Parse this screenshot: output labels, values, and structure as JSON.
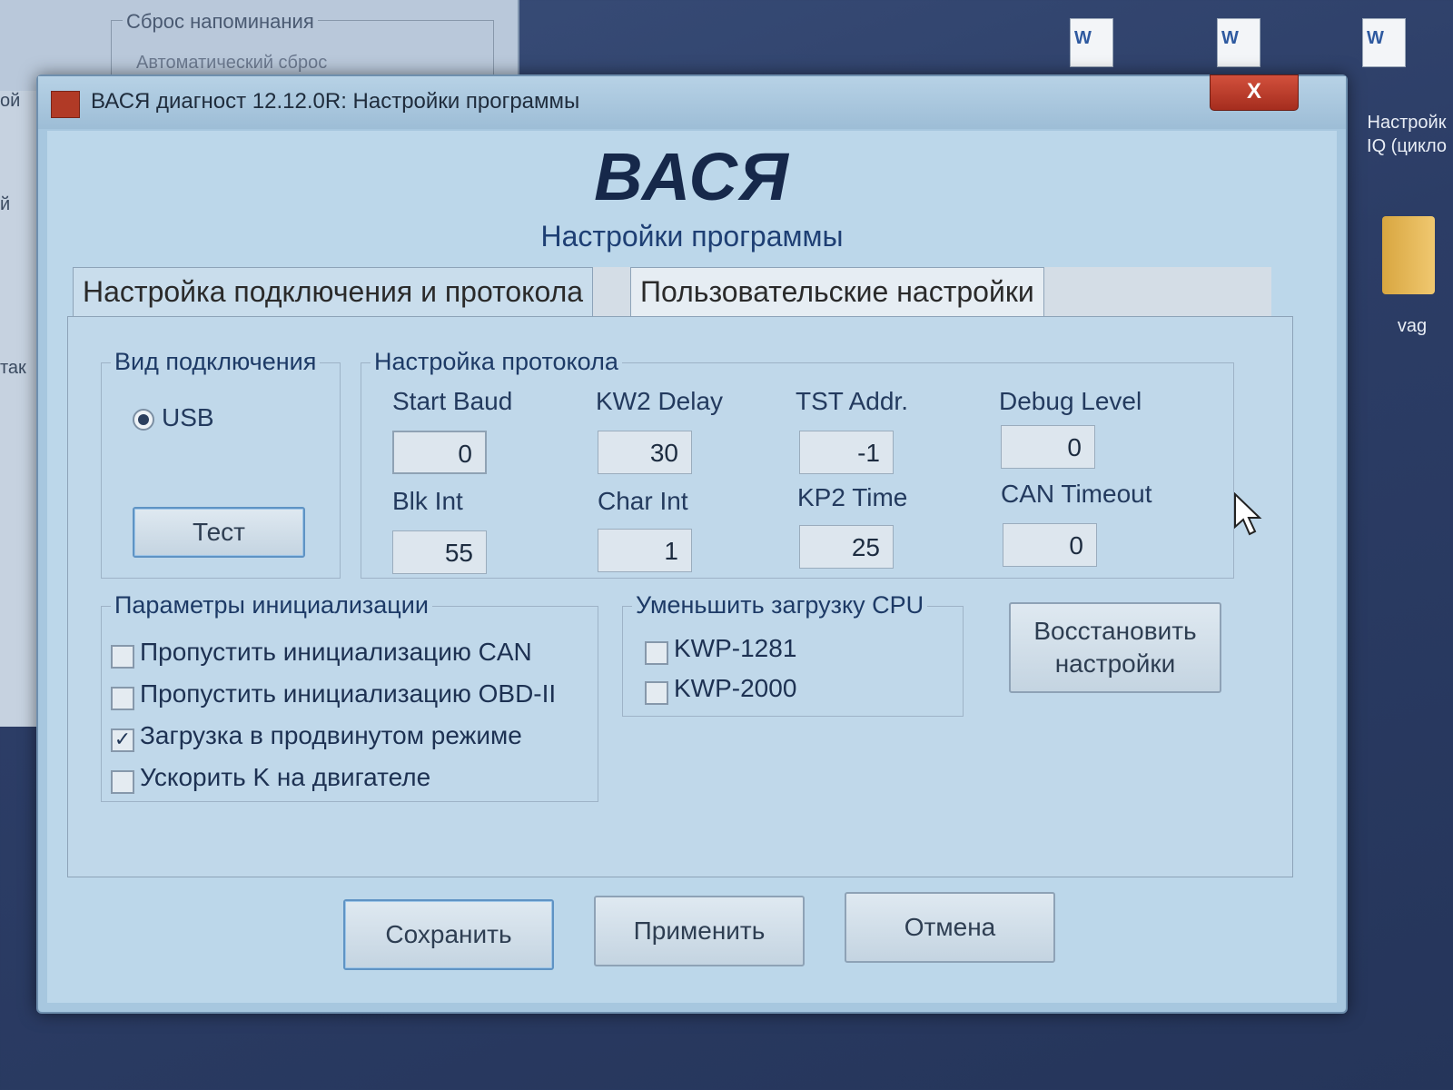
{
  "background_window": {
    "group_label": "Сброс напоминания",
    "sub_text": "Автоматический сброс",
    "left_fragments": [
      "ой",
      "й",
      "так"
    ]
  },
  "desktop": {
    "icon_label_1": "Настройк",
    "icon_label_2": "IQ (цикло",
    "folder_label": "vag"
  },
  "window": {
    "title": "ВАСЯ диагност 12.12.0R:  Настройки программы",
    "close_label": "X",
    "logo": "ВАСЯ",
    "subtitle": "Настройки программы",
    "tabs": [
      {
        "label": "Настройка подключения и протокола",
        "active": true
      },
      {
        "label": "Пользовательские настройки",
        "active": false
      }
    ]
  },
  "connection": {
    "group_label": "Вид подключения",
    "radio_label": "USB",
    "test_button": "Тест"
  },
  "protocol": {
    "group_label": "Настройка протокола",
    "fields": [
      {
        "label": "Start Baud",
        "value": "0"
      },
      {
        "label": "KW2 Delay",
        "value": "30"
      },
      {
        "label": "TST Addr.",
        "value": "-1"
      },
      {
        "label": "Debug Level",
        "value": "0"
      },
      {
        "label": "Blk Int",
        "value": "55"
      },
      {
        "label": "Char Int",
        "value": "1"
      },
      {
        "label": "KP2 Time",
        "value": "25"
      },
      {
        "label": "CAN Timeout",
        "value": "0"
      }
    ]
  },
  "init_params": {
    "group_label": "Параметры инициализации",
    "items": [
      {
        "label": "Пропустить инициализацию CAN",
        "checked": false
      },
      {
        "label": "Пропустить инициализацию OBD-II",
        "checked": false
      },
      {
        "label": "Загрузка в продвинутом режиме",
        "checked": true
      },
      {
        "label": "Ускорить K на двигателе",
        "checked": false
      }
    ]
  },
  "cpu": {
    "group_label": "Уменьшить загрузку CPU",
    "items": [
      {
        "label": "KWP-1281",
        "checked": false
      },
      {
        "label": "KWP-2000",
        "checked": false
      }
    ]
  },
  "restore_button": {
    "line1": "Восстановить",
    "line2": "настройки"
  },
  "footer": {
    "save": "Сохранить",
    "apply": "Применить",
    "cancel": "Отмена"
  },
  "check_mark": "✓"
}
